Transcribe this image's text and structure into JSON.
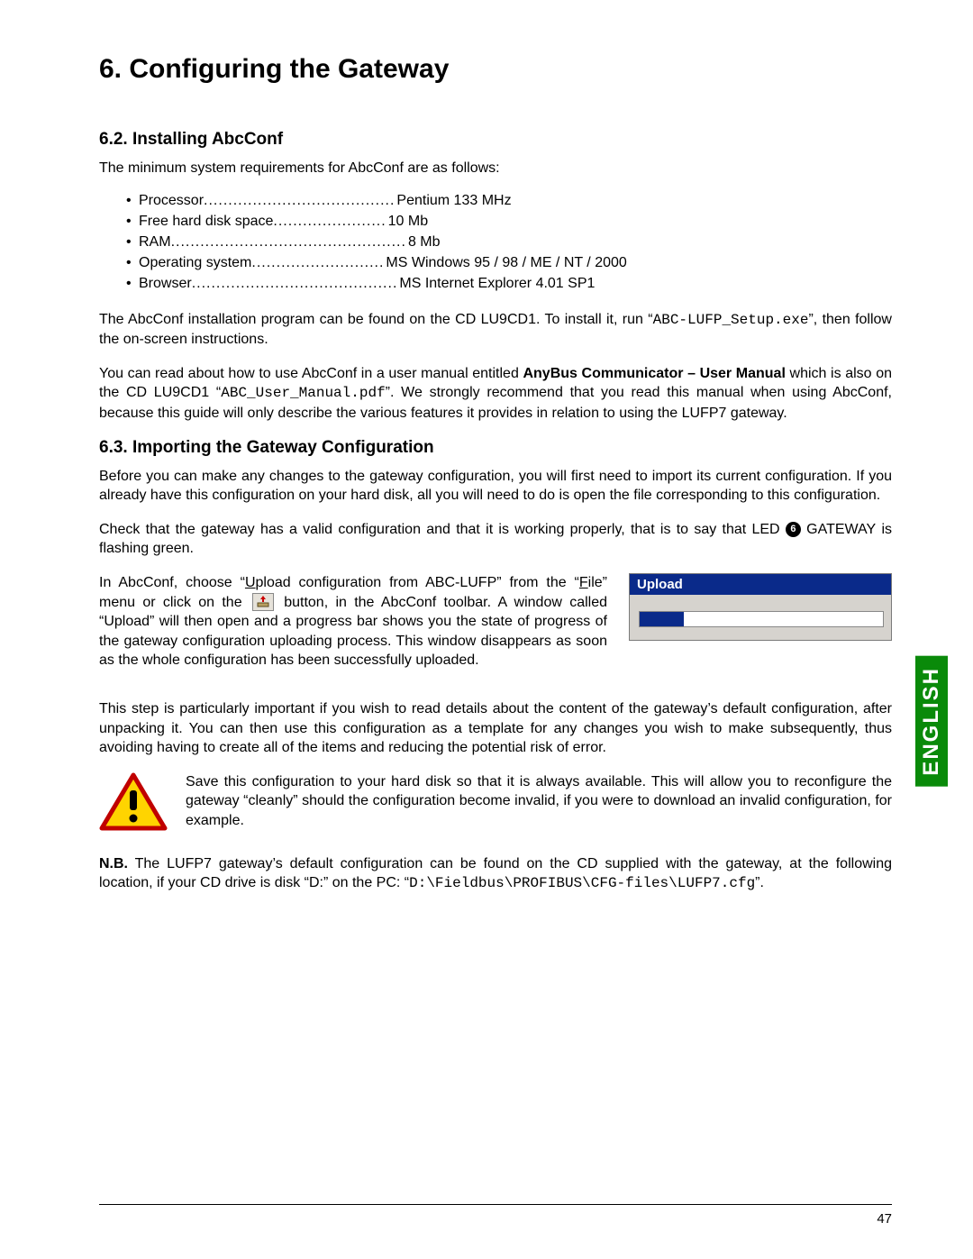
{
  "title": "6. Configuring the Gateway",
  "section62": {
    "heading": "6.2. Installing AbcConf",
    "intro": "The minimum system requirements for AbcConf are as follows:",
    "requirements": [
      {
        "label": "Processor",
        "dots": ".......................................",
        "value": "Pentium 133 MHz"
      },
      {
        "label": "Free hard disk space",
        "dots": ".......................",
        "value": "10 Mb"
      },
      {
        "label": "RAM",
        "dots": "................................................",
        "value": "  8 Mb"
      },
      {
        "label": "Operating system",
        "dots": "...........................",
        "value": "MS Windows 95 / 98 / ME / NT / 2000"
      },
      {
        "label": "Browser",
        "dots": "..........................................",
        "value": "MS Internet Explorer 4.01 SP1"
      }
    ],
    "p1_a": "The AbcConf installation program can be found on the CD LU9CD1. To install it, run “",
    "p1_code": "ABC-LUFP_Setup.exe",
    "p1_b": "”, then follow the on-screen instructions.",
    "p2_a": "You can read about how to use AbcConf in a user manual entitled ",
    "p2_bold": "AnyBus Communicator – User Manual",
    "p2_b": " which is also on the CD LU9CD1 “",
    "p2_code": "ABC_User_Manual.pdf",
    "p2_c": "”. We strongly recommend that you read this manual when using AbcConf, because this guide will only describe the various features it provides in relation to using the LUFP7 gateway."
  },
  "section63": {
    "heading": "6.3. Importing the Gateway Configuration",
    "p1": "Before you can make any changes to the gateway configuration, you will first need to import its current configuration. If you already have this configuration on your hard disk, all you will need to do is open the file corresponding to this configuration.",
    "p2_a": "Check that the gateway has a valid configuration and that it is working properly, that is to say that LED ",
    "led": "6",
    "p2_b": " G",
    "p2_sc": "ATEWAY",
    "p2_c": " is flashing green.",
    "p3_a": "In AbcConf, choose “",
    "p3_u1": "U",
    "p3_b": "pload configuration from ABC-LUFP” from the “",
    "p3_u2": "F",
    "p3_c": "ile” menu or click on the ",
    "p3_d": " button, in the AbcConf toolbar. A window called “Upload” will then open and a progress bar shows you the state of progress of the gateway configuration uploading process. This window disappears as soon as the whole configuration has been successfully uploaded.",
    "upload_title": "Upload",
    "p4": "This step is particularly important if you wish to read details about the content of the gateway’s default configuration, after unpacking it. You can then use this configuration as a template for any changes you wish to make subsequently, thus avoiding having to create all of the items and reducing the potential risk of error.",
    "warn": "Save this configuration to your hard disk so that it is always available. This will allow you to reconfigure the gateway “cleanly” should the configuration become invalid, if you were to download an invalid configuration, for example.",
    "nb_bold": "N.B.",
    "nb_a": " The LUFP7 gateway’s default configuration can be found on the CD supplied with the gateway, at the following location, if your CD drive is disk “D:” on the PC: “",
    "nb_code": "D:\\Fieldbus\\PROFIBUS\\CFG-files\\LUFP7.cfg",
    "nb_b": "”."
  },
  "side_label": "ENGLISH",
  "page_number": "47"
}
